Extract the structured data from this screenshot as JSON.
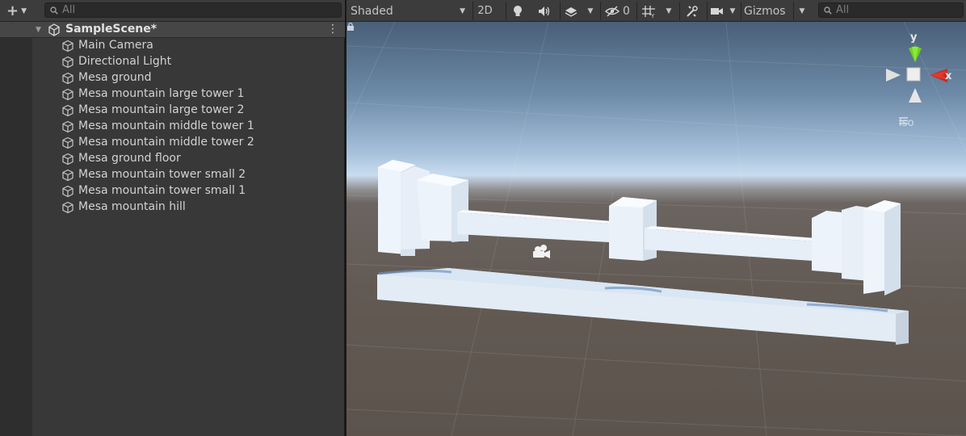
{
  "hierarchy": {
    "add_symbol": "+",
    "search_placeholder": "All",
    "scene": {
      "name": "SampleScene*"
    },
    "items": [
      {
        "label": "Main Camera"
      },
      {
        "label": "Directional Light"
      },
      {
        "label": "Mesa ground"
      },
      {
        "label": "Mesa mountain large tower 1"
      },
      {
        "label": "Mesa mountain large tower 2"
      },
      {
        "label": "Mesa mountain middle tower 1"
      },
      {
        "label": "Mesa mountain middle tower 2"
      },
      {
        "label": "Mesa ground floor"
      },
      {
        "label": "Mesa mountain tower small 2"
      },
      {
        "label": "Mesa mountain tower small 1"
      },
      {
        "label": "Mesa mountain hill"
      }
    ]
  },
  "scene_view": {
    "shading_mode": "Shaded",
    "mode_2d": "2D",
    "hidden_count": "0",
    "gizmos_label": "Gizmos",
    "search_placeholder": "All",
    "projection": "Iso",
    "axis_y": "y",
    "axis_x": "x"
  },
  "colors": {
    "panel_bg": "#383838",
    "toolbar_bg": "#3c3c3c",
    "selection_row": "#464646",
    "axis_x": "#c8281e",
    "axis_y": "#6ed21e",
    "sky": "#a9c3dd",
    "ground": "#635a54",
    "block": "#eef4fb"
  }
}
